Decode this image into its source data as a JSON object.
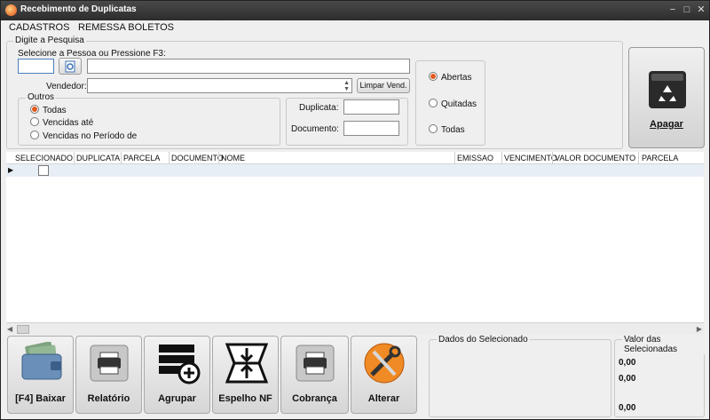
{
  "window": {
    "title": "Recebimento de Duplicatas",
    "controls": [
      "−",
      "□",
      "✕"
    ]
  },
  "menu": [
    "CADASTROS",
    "REMESSA BOLETOS"
  ],
  "search": {
    "group_title": "Digite a Pesquisa",
    "person_label": "Selecione a Pessoa ou Pressione F3:",
    "person_code": "",
    "person_name": "",
    "vendor_label": "Vendedor:",
    "vendor_value": "",
    "clear_vendor_label": "Limpar Vend."
  },
  "outros": {
    "title": "Outros",
    "options": [
      "Todas",
      "Vencidas até",
      "Vencidas no Período de"
    ],
    "selected": 0
  },
  "fields": {
    "duplicata_label": "Duplicata:",
    "duplicata_value": "",
    "documento_label": "Documento:",
    "documento_value": ""
  },
  "status": {
    "options": [
      "Abertas",
      "Quitadas",
      "Todas"
    ],
    "selected": 0
  },
  "apagar_label": "Apagar",
  "grid": {
    "columns": [
      "SELECIONADO",
      "DUPLICATA",
      "PARCELA",
      "DOCUMENTO",
      "NOME",
      "EMISSAO",
      "VENCIMENTO",
      "VALOR DOCUMENTO",
      "PARCELA"
    ],
    "row_checked": false
  },
  "actions": [
    "[F4] Baixar",
    "Relatório",
    "Agrupar",
    "Espelho NF",
    "Cobrança",
    "Alterar"
  ],
  "dados_title": "Dados do Selecionado",
  "valor_title": "Valor das Selecionadas",
  "values": [
    "0,00",
    "0,00",
    "0,00"
  ],
  "colors": {
    "accent": "#e05a1e",
    "titlebar": "#2c2c2c"
  }
}
